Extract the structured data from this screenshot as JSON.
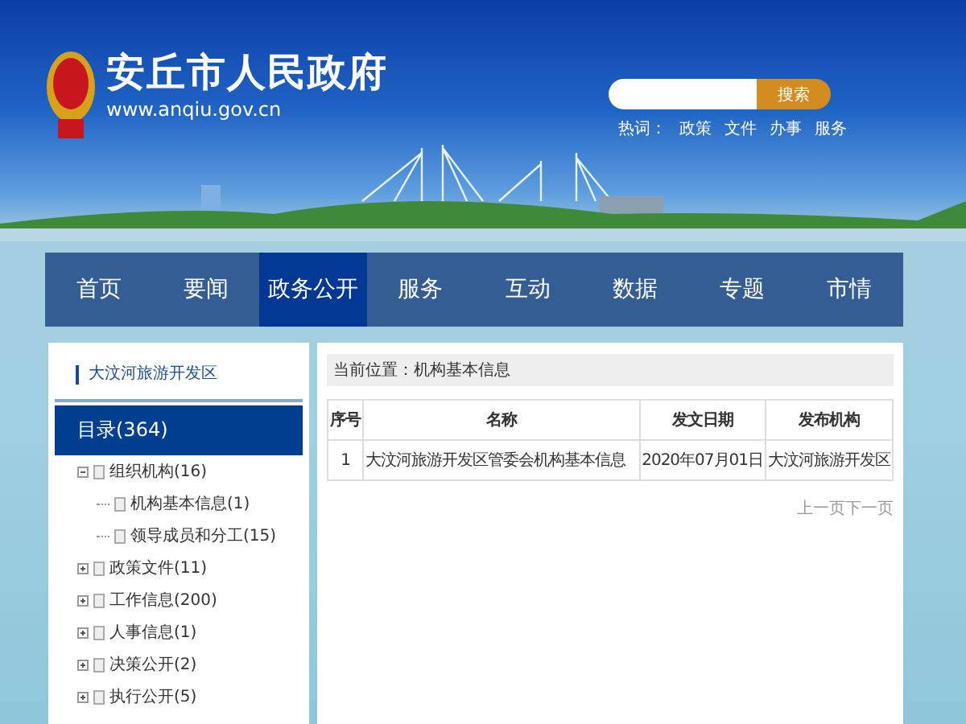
{
  "site": {
    "title": "安丘市人民政府",
    "url": "www.anqiu.gov.cn"
  },
  "search": {
    "button": "搜索",
    "hot_label": "热词：",
    "hot_words": [
      "政策",
      "文件",
      "办事",
      "服务"
    ]
  },
  "nav": [
    {
      "label": "首页",
      "selected": false
    },
    {
      "label": "要闻",
      "selected": false
    },
    {
      "label": "政务公开",
      "selected": true
    },
    {
      "label": "服务",
      "selected": false
    },
    {
      "label": "互动",
      "selected": false
    },
    {
      "label": "数据",
      "selected": false
    },
    {
      "label": "专题",
      "selected": false
    },
    {
      "label": "市情",
      "selected": false
    }
  ],
  "sidebar": {
    "title": "大汶河旅游开发区",
    "catalog": "目录(364)",
    "tree": [
      {
        "label": "组织机构(16)",
        "expanded": true,
        "children": [
          {
            "label": "机构基本信息(1)"
          },
          {
            "label": "领导成员和分工(15)"
          }
        ]
      },
      {
        "label": "政策文件(11)",
        "expanded": false
      },
      {
        "label": "工作信息(200)",
        "expanded": false
      },
      {
        "label": "人事信息(1)",
        "expanded": false
      },
      {
        "label": "决策公开(2)",
        "expanded": false
      },
      {
        "label": "执行公开(5)",
        "expanded": false
      }
    ]
  },
  "breadcrumb": {
    "label": "当前位置：",
    "current": "机构基本信息"
  },
  "table": {
    "columns": [
      "序号",
      "名称",
      "发文日期",
      "发布机构"
    ],
    "rows": [
      [
        "1",
        "大汶河旅游开发区管委会机构基本信息",
        "2020年07月01日",
        "大汶河旅游开发区"
      ]
    ]
  },
  "pager": [
    "上一页",
    "下一页"
  ]
}
